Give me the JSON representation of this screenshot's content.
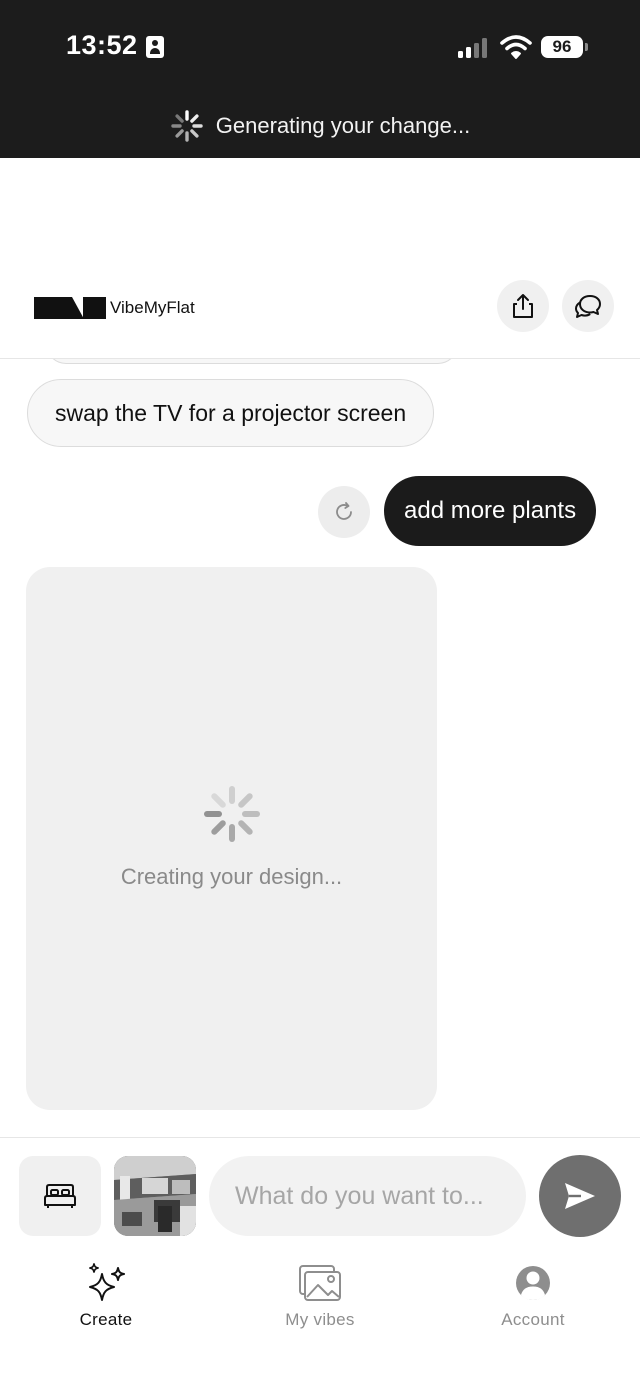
{
  "status_bar": {
    "time": "13:52",
    "battery": "96",
    "banner_text": "Generating your change..."
  },
  "header": {
    "brand": "VibeMyFlat",
    "share_icon": "share-icon",
    "feedback_icon": "chat-bubbles-icon"
  },
  "chat": {
    "messages": [
      {
        "role": "assistant-suggestion",
        "text": "swap the TV for a projector screen"
      },
      {
        "role": "user",
        "text": "add more plants"
      }
    ],
    "generating_text": "Creating your design..."
  },
  "composer": {
    "placeholder": "What do you want to...",
    "room_icon": "bed-icon",
    "send_icon": "send-arrow-icon"
  },
  "tabs": [
    {
      "label": "Create",
      "icon": "sparkles-icon",
      "active": true
    },
    {
      "label": "My vibes",
      "icon": "gallery-icon",
      "active": false
    },
    {
      "label": "Account",
      "icon": "person-circle-icon",
      "active": false
    }
  ],
  "colors": {
    "status_bar_bg": "#1c1c1c",
    "user_bubble_bg": "#1b1b1b",
    "card_bg": "#f0f0f0",
    "send_button_bg": "#6f6f6f",
    "inactive_tab": "#8e8e8e"
  }
}
